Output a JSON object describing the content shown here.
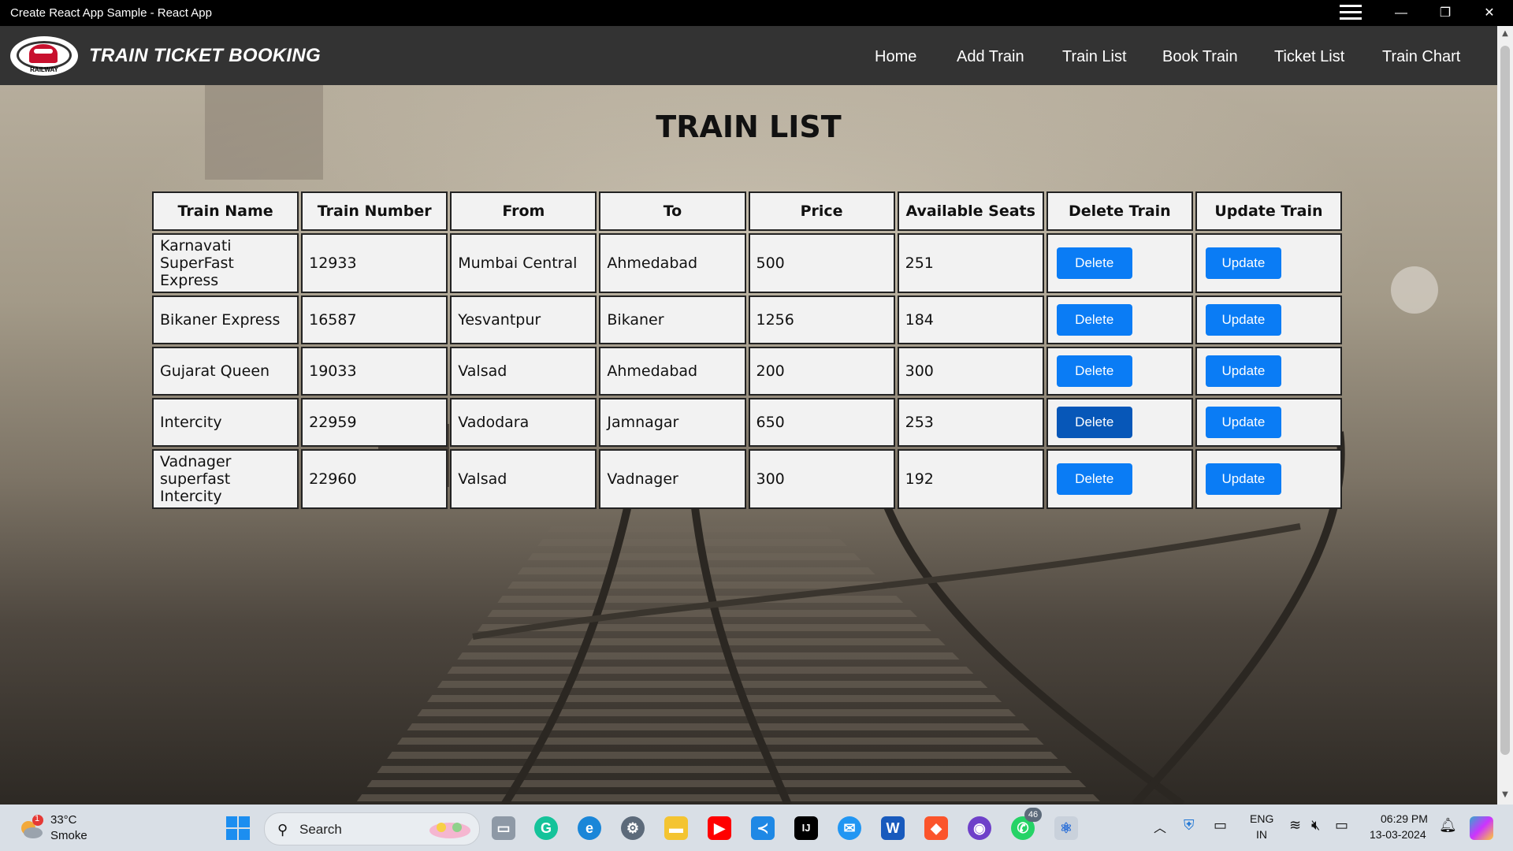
{
  "window": {
    "title": "Create React App Sample - React App",
    "controls": {
      "minimize": "—",
      "maximize": "❐",
      "close": "✕"
    }
  },
  "navbar": {
    "logo_text": "RAILWAY",
    "brand": "TRAIN TICKET BOOKING",
    "links": [
      "Home",
      "Add Train",
      "Train List",
      "Book Train",
      "Ticket List",
      "Train Chart"
    ]
  },
  "page": {
    "title": "TRAIN LIST",
    "table": {
      "headers": [
        "Train Name",
        "Train Number",
        "From",
        "To",
        "Price",
        "Available Seats",
        "Delete Train",
        "Update Train"
      ],
      "rows": [
        {
          "name": "Karnavati SuperFast Express",
          "number": "12933",
          "from": "Mumbai Central",
          "to": "Ahmedabad",
          "price": "500",
          "seats": "251",
          "delete": "Delete",
          "update": "Update"
        },
        {
          "name": "Bikaner Express",
          "number": "16587",
          "from": "Yesvantpur",
          "to": "Bikaner",
          "price": "1256",
          "seats": "184",
          "delete": "Delete",
          "update": "Update"
        },
        {
          "name": "Gujarat Queen",
          "number": "19033",
          "from": "Valsad",
          "to": "Ahmedabad",
          "price": "200",
          "seats": "300",
          "delete": "Delete",
          "update": "Update"
        },
        {
          "name": "Intercity",
          "number": "22959",
          "from": "Vadodara",
          "to": "Jamnagar",
          "price": "650",
          "seats": "253",
          "delete": "Delete",
          "update": "Update"
        },
        {
          "name": "Vadnager superfast Intercity",
          "number": "22960",
          "from": "Valsad",
          "to": "Vadnager",
          "price": "300",
          "seats": "192",
          "delete": "Delete",
          "update": "Update"
        }
      ]
    }
  },
  "colors": {
    "navbar_bg": "#333333",
    "button_blue": "#0a7cf5",
    "button_hover": "#0757b8"
  },
  "taskbar": {
    "weather": {
      "temp": "33°C",
      "condition": "Smoke",
      "badge": "1"
    },
    "search_placeholder": "Search",
    "whatsapp_badge": "46",
    "language": {
      "lang": "ENG",
      "region": "IN"
    },
    "clock": {
      "time": "06:29 PM",
      "date": "13-03-2024"
    }
  }
}
